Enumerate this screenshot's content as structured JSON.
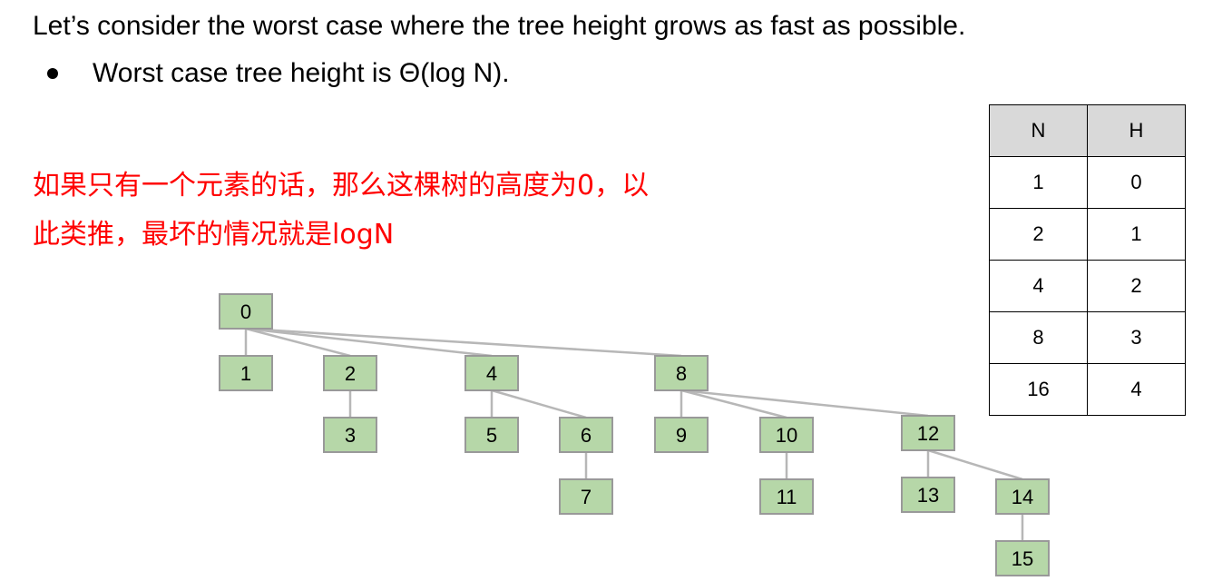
{
  "heading": "Let’s consider the worst case where the tree height grows as fast as possible.",
  "bullet": "Worst case tree height is Θ(log N).",
  "note_lines": [
    "如果只有一个元素的话，那么这棵树的高度为0，以",
    "此类推，最坏的情况就是logN"
  ],
  "table": {
    "headers": [
      "N",
      "H"
    ],
    "rows": [
      [
        "1",
        "0"
      ],
      [
        "2",
        "1"
      ],
      [
        "4",
        "2"
      ],
      [
        "8",
        "3"
      ],
      [
        "16",
        "4"
      ]
    ]
  },
  "tree": {
    "node_fill": "#b6d7a8",
    "node_stroke": "#999999",
    "edge_color": "#b7b7b7",
    "nodes": [
      "0",
      "1",
      "2",
      "3",
      "4",
      "5",
      "6",
      "7",
      "8",
      "9",
      "10",
      "11",
      "12",
      "13",
      "14",
      "15"
    ],
    "edges": [
      [
        "0",
        "1"
      ],
      [
        "0",
        "2"
      ],
      [
        "0",
        "4"
      ],
      [
        "0",
        "8"
      ],
      [
        "2",
        "3"
      ],
      [
        "4",
        "5"
      ],
      [
        "4",
        "6"
      ],
      [
        "6",
        "7"
      ],
      [
        "8",
        "9"
      ],
      [
        "8",
        "10"
      ],
      [
        "8",
        "12"
      ],
      [
        "10",
        "11"
      ],
      [
        "12",
        "13"
      ],
      [
        "12",
        "14"
      ],
      [
        "14",
        "15"
      ]
    ]
  }
}
